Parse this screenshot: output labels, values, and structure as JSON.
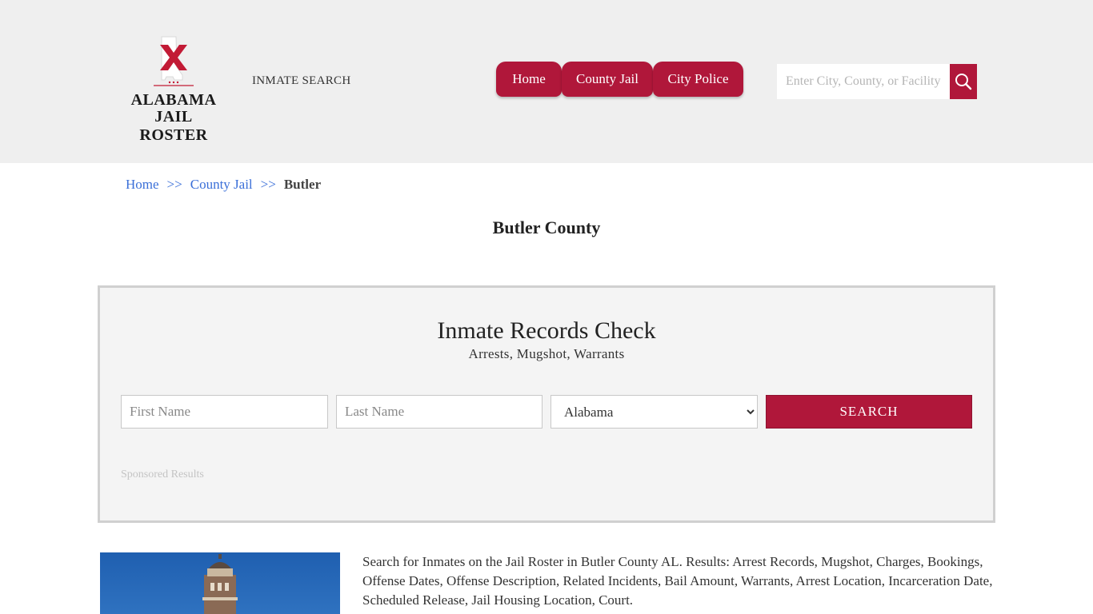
{
  "header": {
    "logo_line1": "ALABAMA",
    "logo_line2": "JAIL ROSTER",
    "tagline": "INMATE SEARCH",
    "nav": [
      "Home",
      "County Jail",
      "City Police"
    ],
    "search_placeholder": "Enter City, County, or Facility",
    "accent_color": "#b0173a"
  },
  "breadcrumb": {
    "home": "Home",
    "sep": ">>",
    "county_jail": "County Jail",
    "current": "Butler"
  },
  "page_title": "Butler County",
  "records": {
    "title": "Inmate Records Check",
    "subtitle": "Arrests, Mugshot, Warrants",
    "first_name_placeholder": "First Name",
    "last_name_placeholder": "Last Name",
    "state_selected": "Alabama",
    "search_label": "SEARCH",
    "sponsored": "Sponsored Results"
  },
  "intro_text": "Search for Inmates on the Jail Roster in Butler County AL. Results: Arrest Records, Mugshot, Charges, Bookings, Offense Dates, Offense Description, Related Incidents, Bail Amount, Warrants, Arrest Location, Incarceration Date, Scheduled Release, Jail Housing Location, Court."
}
